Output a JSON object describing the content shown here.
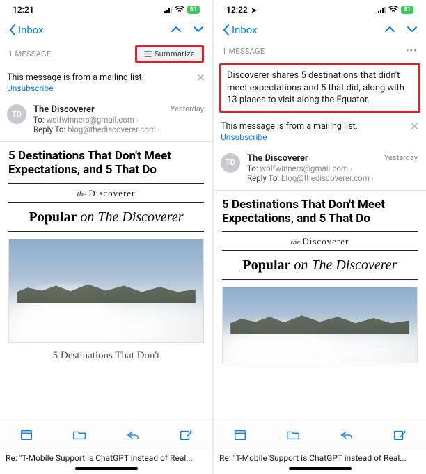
{
  "left": {
    "status": {
      "time": "12:21",
      "battery": "81",
      "location_arrow": false
    },
    "back_label": "Inbox",
    "message_count": "1 MESSAGE",
    "summarize_label": "Summarize",
    "mailing_list_notice": "This message is from a mailing list.",
    "unsubscribe_label": "Unsubscribe",
    "sender_initials": "TD",
    "sender_name": "The Discoverer",
    "to_label": "To:",
    "to_value": "wolfwinners@gmail.com",
    "reply_to_label": "Reply To:",
    "reply_to_value": "blog@thediscoverer.com",
    "timestamp": "Yesterday",
    "subject": "5 Destinations That Don't Meet Expectations, and 5 That Do",
    "brand_the": "the",
    "brand_name": "Discoverer",
    "popular_bold": "Popular",
    "popular_on": "on",
    "popular_name": "The Discoverer",
    "caption": "5 Destinations That Don't",
    "preview": "Re: \"T-Mobile Support is ChatGPT instead of Real..."
  },
  "right": {
    "status": {
      "time": "12:22",
      "battery": "81",
      "location_arrow": true
    },
    "back_label": "Inbox",
    "message_count": "1 MESSAGE",
    "summary_text": "Discoverer shares 5 destinations that didn't meet expectations and 5 that did, along with 13 places to visit along the Equator.",
    "mailing_list_notice": "This message is from a mailing list.",
    "unsubscribe_label": "Unsubscribe",
    "sender_initials": "TD",
    "sender_name": "The Discoverer",
    "to_label": "To:",
    "to_value": "wolfwinners@gmail.com",
    "reply_to_label": "Reply To:",
    "reply_to_value": "blog@thediscoverer.com",
    "timestamp": "Yesterday",
    "subject": "5 Destinations That Don't Meet Expectations, and 5 That Do",
    "brand_the": "the",
    "brand_name": "Discoverer",
    "popular_bold": "Popular",
    "popular_on": "on",
    "popular_name": "The Discoverer",
    "preview": "Re: \"T-Mobile Support is ChatGPT instead of Real..."
  }
}
